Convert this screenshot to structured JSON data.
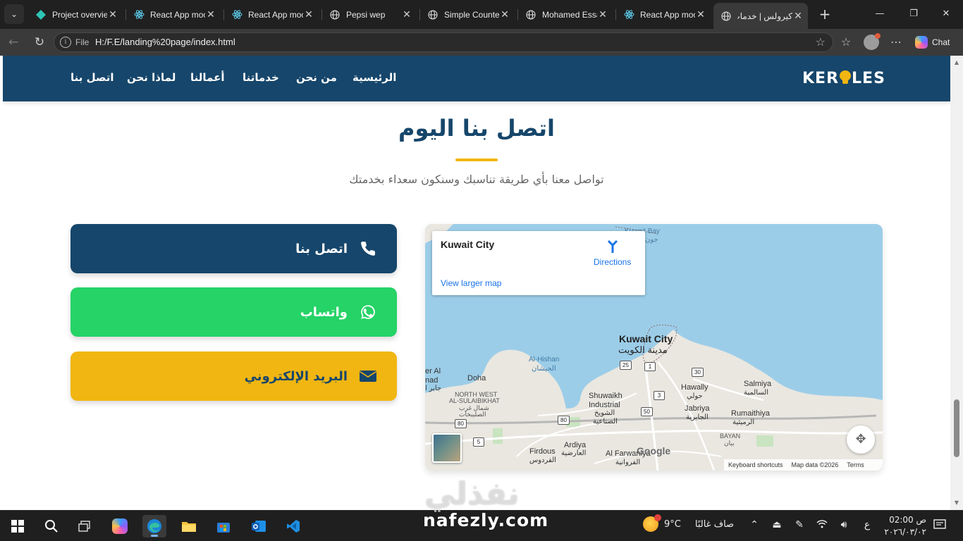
{
  "browser": {
    "tabs": [
      {
        "title": "Project overview",
        "icon": "diamond-icon"
      },
      {
        "title": "React App moo",
        "icon": "react-icon"
      },
      {
        "title": "React App moo",
        "icon": "react-icon"
      },
      {
        "title": "Pepsi wep",
        "icon": "globe-icon"
      },
      {
        "title": "Simple Counter",
        "icon": "globe-icon"
      },
      {
        "title": "Mohamed Essa",
        "icon": "globe-icon"
      },
      {
        "title": "React App moo",
        "icon": "react-icon"
      },
      {
        "title": "كيرولس | خدمات",
        "icon": "globe-icon",
        "active": true
      }
    ],
    "address": {
      "scheme_label": "File",
      "url": "H:/F.E/landing%20page/index.html"
    },
    "chat_label": "Chat"
  },
  "site": {
    "logo": {
      "pre": "KER",
      "post": "LES"
    },
    "nav": [
      "الرئيسية",
      "من نحن",
      "خدماتنا",
      "أعمالنا",
      "لماذا نحن",
      "اتصل بنا"
    ],
    "section": {
      "title": "اتصل بنا اليوم",
      "subtitle": "تواصل معنا بأي طريقة تناسبك وسنكون سعداء بخدمتك"
    },
    "buttons": {
      "phone": "اتصل بنا",
      "whatsapp": "واتساب",
      "email": "البريد الإلكتروني"
    },
    "colors": {
      "primary": "#16466b",
      "accent": "#f1b612",
      "whatsapp": "#25d366"
    }
  },
  "map": {
    "card": {
      "city": "Kuwait City",
      "directions": "Directions",
      "view_larger": "View larger map"
    },
    "labels": {
      "kuwait_city_en": "Kuwait City",
      "kuwait_city_ar": "مدينة الكويت",
      "al_hishan_en": "Al-Hishan",
      "al_hishan_ar": "الحيشان",
      "doha": "Doha",
      "jaber_al_en": "er Al",
      "jaber_al_en2": "nad",
      "jaber_al_ar": "جابر ا",
      "nw_sulaibikhat_en1": "NORTH WEST",
      "nw_sulaibikhat_en2": "AL-SULAIBIKHAT",
      "nw_sulaibikhat_ar1": "شمال غرب",
      "nw_sulaibikhat_ar2": "الصليبخات",
      "shuwaikh_en1": "Shuwaikh",
      "shuwaikh_en2": "Industrial",
      "shuwaikh_ar1": "الشويخ",
      "shuwaikh_ar2": "الصناعية",
      "hawally_en": "Hawally",
      "hawally_ar": "حولي",
      "jabriya_en": "Jabriya",
      "jabriya_ar": "الجابرية",
      "salmiya_en": "Salmiya",
      "salmiya_ar": "السالمية",
      "rumaithiya_en": "Rumaithiya",
      "rumaithiya_ar": "الرميثية",
      "bayan_en": "BAYAN",
      "bayan_ar": "بيان",
      "ardiya_en": "Ardiya",
      "ardiya_ar": "العارضية",
      "firdous_en": "Firdous",
      "firdous_ar": "الفردوس",
      "farwaniya_en": "Al Farwaniya",
      "farwaniya_ar": "الفروانية",
      "kuwait_bay_en": "Kuwait Bay",
      "kuwait_bay_ar": "جون"
    },
    "roads": [
      "25",
      "1",
      "30",
      "3",
      "50",
      "80",
      "80",
      "5",
      "25"
    ],
    "google": "Google",
    "footer": {
      "shortcuts": "Keyboard shortcuts",
      "data": "Map data ©2026",
      "terms": "Terms"
    }
  },
  "taskbar": {
    "weather": {
      "temp": "9°C",
      "condition": "صاف غالبًا"
    },
    "lang": "ع",
    "clock": {
      "time": "02:00 ص",
      "date": "٢٠٢٦/٠٣/٠٢"
    }
  },
  "watermark": {
    "ar": "نفذلي",
    "en": "nafezly.com"
  }
}
